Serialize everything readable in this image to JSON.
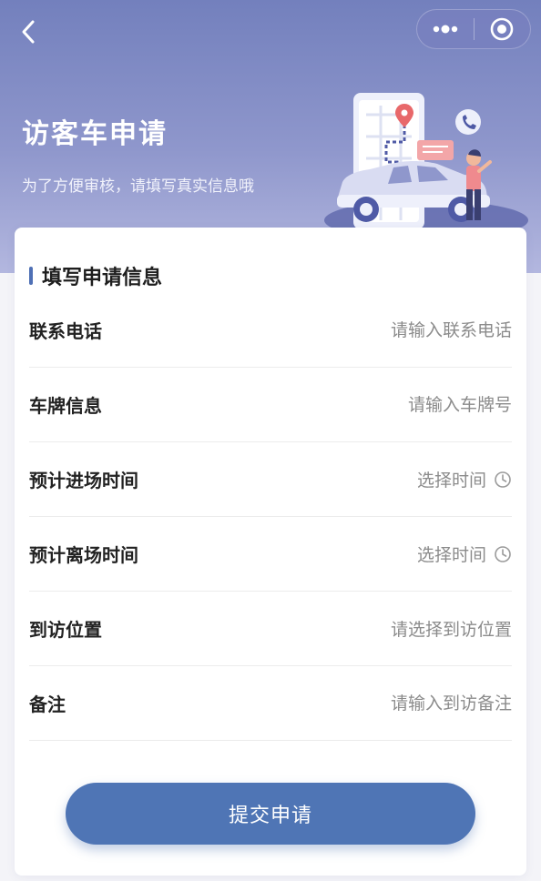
{
  "header": {
    "back_icon": "chevron-left-icon",
    "more_icon": "more-dots-icon",
    "close_icon": "target-circle-icon"
  },
  "hero": {
    "title": "访客车申请",
    "subtitle": "为了方便审核，请填写真实信息哦",
    "gradient_top": "#7380bd",
    "gradient_bottom": "#b3b7df"
  },
  "form": {
    "section_title": "填写申请信息",
    "rows": [
      {
        "label": "联系电话",
        "placeholder": "请输入联系电话",
        "kind": "input"
      },
      {
        "label": "车牌信息",
        "placeholder": "请输入车牌号",
        "kind": "input"
      },
      {
        "label": "预计进场时间",
        "value": "选择时间",
        "kind": "time-picker",
        "icon": "clock-icon"
      },
      {
        "label": "预计离场时间",
        "value": "选择时间",
        "kind": "time-picker",
        "icon": "clock-icon"
      },
      {
        "label": "到访位置",
        "value": "请选择到访位置",
        "kind": "picker"
      },
      {
        "label": "备注",
        "placeholder": "请输入到访备注",
        "kind": "input"
      }
    ]
  },
  "submit": {
    "label": "提交申请",
    "color": "#4f75b5"
  },
  "accent_color": "#4f70b5"
}
